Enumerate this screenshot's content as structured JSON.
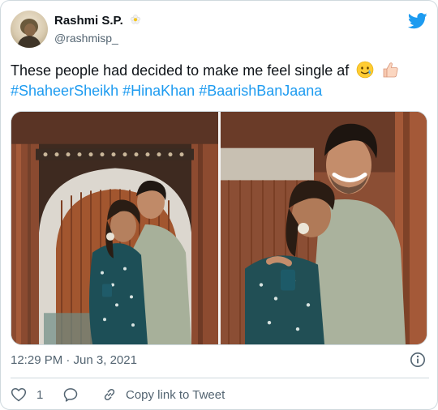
{
  "tweet": {
    "author_name": "Rashmi S.P.",
    "handle": "@rashmisp_",
    "text": "These people had decided to make me feel single af",
    "hashtags": [
      "#ShaheerSheikh",
      "#HinaKhan",
      "#BaarishBanJaana"
    ],
    "timestamp": "12:29 PM · Jun 3, 2021",
    "like_count": "1",
    "copy_link_label": "Copy link to Tweet"
  },
  "icons": {
    "name_badge": "flower-icon",
    "platform": "twitter-bird-icon",
    "text_emojis": [
      "crying-smile-emoji",
      "thumbs-up-emoji"
    ],
    "info": "info-icon",
    "like": "heart-icon",
    "reply": "reply-icon",
    "copy_link": "link-icon"
  },
  "colors": {
    "accent": "#1d9bf0",
    "text": "#0f1419",
    "secondary_text": "#536471",
    "border": "#cfd9de"
  }
}
